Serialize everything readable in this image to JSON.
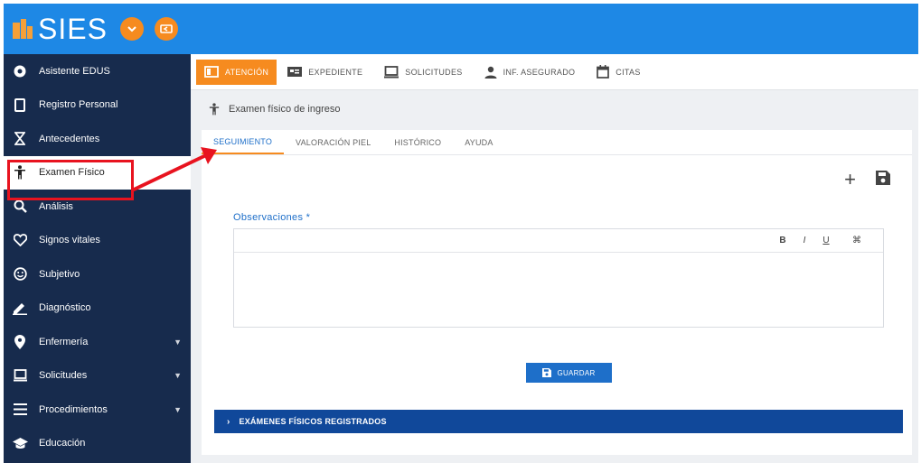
{
  "app": {
    "title": "SIES",
    "menu_toggle_icon": "chevron-down-icon",
    "back_icon": "arrow-back-icon",
    "brand_color": "#1e88e5",
    "accent_color": "#f68b1f",
    "sidebar_color": "#172b4d"
  },
  "sidebar": {
    "items": [
      {
        "label": "Asistente EDUS",
        "icon": "gear-icon",
        "has_children": false
      },
      {
        "label": "Registro Personal",
        "icon": "tablet-icon",
        "has_children": false
      },
      {
        "label": "Antecedentes",
        "icon": "hourglass-icon",
        "has_children": false
      },
      {
        "label": "Examen Físico",
        "icon": "person-icon",
        "has_children": false,
        "active": true
      },
      {
        "label": "Análisis",
        "icon": "zoom-icon",
        "has_children": false
      },
      {
        "label": "Signos vitales",
        "icon": "heart-icon",
        "has_children": false
      },
      {
        "label": "Subjetivo",
        "icon": "smiley-icon",
        "has_children": false
      },
      {
        "label": "Diagnóstico",
        "icon": "pencil-icon",
        "has_children": false
      },
      {
        "label": "Enfermería",
        "icon": "location-icon",
        "has_children": true
      },
      {
        "label": "Solicitudes",
        "icon": "laptop-icon",
        "has_children": true
      },
      {
        "label": "Procedimientos",
        "icon": "list-icon",
        "has_children": true
      },
      {
        "label": "Educación",
        "icon": "graduation-icon",
        "has_children": false
      }
    ]
  },
  "main_tabs": [
    {
      "label": "ATENCIÓN",
      "icon": "card-icon",
      "active": true
    },
    {
      "label": "EXPEDIENTE",
      "icon": "folder-icon",
      "active": false
    },
    {
      "label": "SOLICITUDES",
      "icon": "laptop-icon",
      "active": false
    },
    {
      "label": "INF. ASEGURADO",
      "icon": "user-icon",
      "active": false
    },
    {
      "label": "CITAS",
      "icon": "calendar-icon",
      "active": false
    }
  ],
  "breadcrumb": {
    "label": "Examen físico de ingreso",
    "icon": "person-icon"
  },
  "sub_tabs": [
    {
      "label": "SEGUIMIENTO",
      "active": true
    },
    {
      "label": "VALORACIÓN PIEL",
      "active": false
    },
    {
      "label": "HISTÓRICO",
      "active": false
    },
    {
      "label": "AYUDA",
      "active": false
    }
  ],
  "form": {
    "observaciones_label": "Observaciones *",
    "editor_value": "",
    "editor_toolbar": [
      "B",
      "I",
      "U",
      "⌘"
    ],
    "save_label": "GUARDAR"
  },
  "panel": {
    "label": "EXÁMENES FÍSICOS REGISTRADOS"
  }
}
